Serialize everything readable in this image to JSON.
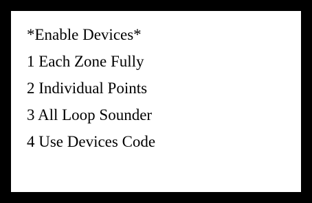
{
  "menu": {
    "title": "*Enable Devices*",
    "items": [
      {
        "label": "1 Each Zone Fully"
      },
      {
        "label": "2 Individual Points"
      },
      {
        "label": "3 All Loop Sounder"
      },
      {
        "label": "4 Use Devices Code"
      }
    ]
  }
}
